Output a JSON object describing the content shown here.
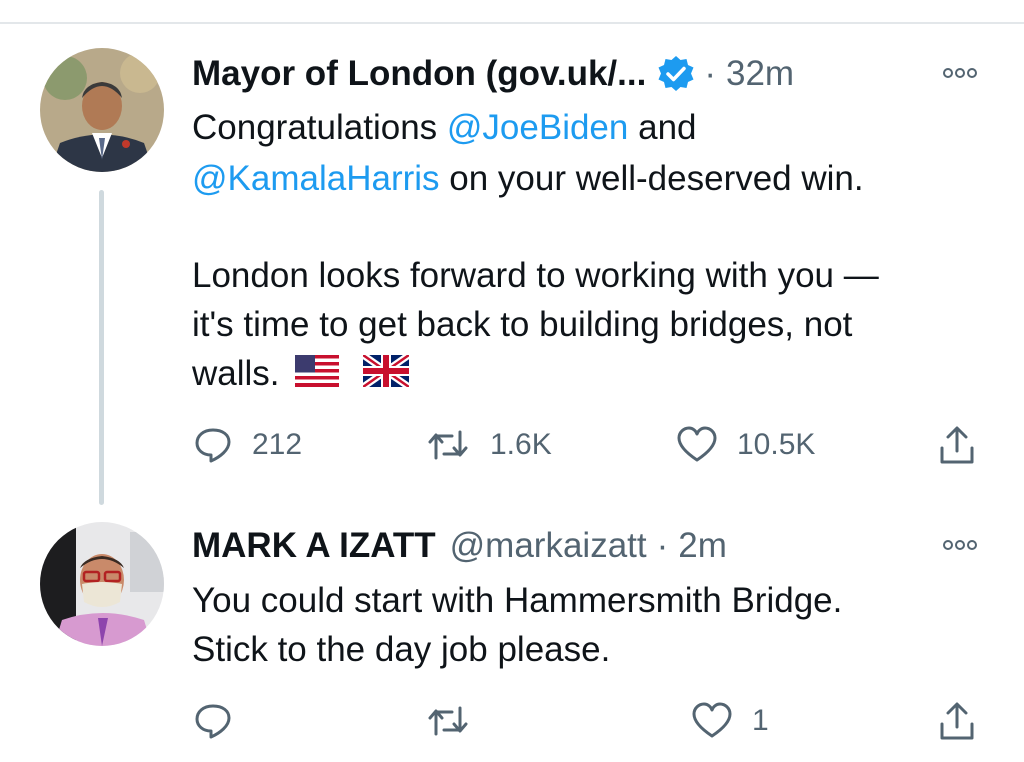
{
  "tweet1": {
    "name": "Mayor of London (gov.uk/...",
    "dot": "·",
    "time": "32m",
    "line1_prefix": "Congratulations ",
    "mention1": "@JoeBiden",
    "line1_suffix": " and",
    "mention2": "@KamalaHarris",
    "line2_suffix": " on your well-deserved win.",
    "line3": "London looks forward to working with you —",
    "line4": "it's time to get back to building bridges, not",
    "line5": "walls.",
    "reply_count": "212",
    "retweet_count": "1.6K",
    "like_count": "10.5K"
  },
  "tweet2": {
    "name": "MARK A IZATT",
    "handle": "@markaizatt",
    "dot": "·",
    "time": "2m",
    "line1": "You could start with Hammersmith Bridge.",
    "line2": "Stick to the day job please.",
    "like_count": "1"
  },
  "icons": [
    "verified-badge-icon",
    "more-options-icon",
    "reply-icon",
    "retweet-icon",
    "like-icon",
    "share-icon",
    "us-flag-icon",
    "uk-flag-icon"
  ],
  "colors": {
    "mention": "#1d9bf0",
    "secondary": "#536471",
    "verified": "#1d9bf0"
  }
}
